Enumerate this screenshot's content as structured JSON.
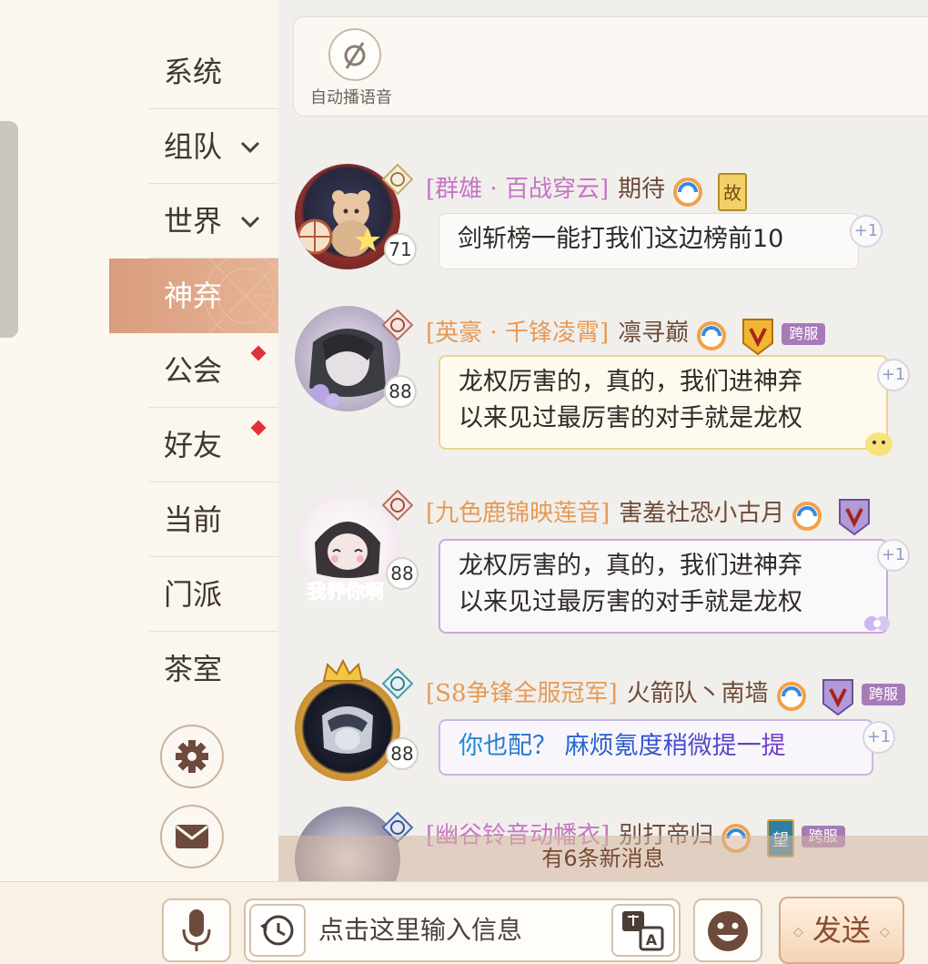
{
  "sidebar": {
    "items": [
      {
        "label": "系统",
        "active": false,
        "dropdown": false,
        "dot": false
      },
      {
        "label": "组队",
        "active": false,
        "dropdown": true,
        "dot": false
      },
      {
        "label": "世界",
        "active": false,
        "dropdown": true,
        "dot": false
      },
      {
        "label": "神弃",
        "active": true,
        "dropdown": false,
        "dot": false
      },
      {
        "label": "公会",
        "active": false,
        "dropdown": false,
        "dot": true
      },
      {
        "label": "好友",
        "active": false,
        "dropdown": false,
        "dot": true
      },
      {
        "label": "当前",
        "active": false,
        "dropdown": false,
        "dot": false
      },
      {
        "label": "门派",
        "active": false,
        "dropdown": false,
        "dot": false
      },
      {
        "label": "茶室",
        "active": false,
        "dropdown": false,
        "dot": false
      }
    ],
    "settings_icon": "gear-icon",
    "mail_icon": "mail-icon"
  },
  "auto_voice": {
    "label": "自动播语音",
    "icon": "mute-icon"
  },
  "messages": [
    {
      "guild": "[群雄 · 百战穿云]",
      "name": "期待",
      "level": "71",
      "badge": "故",
      "cross": "",
      "lines": [
        "剑斩榜一能打我们这边榜前10"
      ],
      "plus": "+1"
    },
    {
      "guild": "[英豪 · 千锋凌霄]",
      "name": "凛寻巅",
      "level": "88",
      "badge": "",
      "cross": "跨服",
      "lines": [
        "龙权厉害的，真的，我们进神弃",
        "以来见过最厉害的对手就是龙权"
      ],
      "plus": "+1"
    },
    {
      "guild": "[九色鹿锦映莲音]",
      "name": "害羞社恐小古月",
      "level": "88",
      "badge": "",
      "cross": "",
      "avatar_caption": "我养你啊",
      "lines": [
        "龙权厉害的，真的，我们进神弃",
        "以来见过最厉害的对手就是龙权"
      ],
      "plus": "+1"
    },
    {
      "guild": "[S8争锋全服冠军]",
      "name": "火箭队丶南墙",
      "level": "88",
      "badge": "",
      "cross": "跨服",
      "lines": [
        "你也配？ 麻烦氪度稍微提一提"
      ],
      "plus": "+1"
    },
    {
      "guild": "[幽谷铃音动幡衣]",
      "name": "别打帝归",
      "level": "",
      "badge": "望",
      "cross": "跨服",
      "lines": [],
      "plus": ""
    }
  ],
  "new_messages_banner": "有6条新消息",
  "bottom_bar": {
    "mic_icon": "microphone-icon",
    "history_icon": "history-icon",
    "input_placeholder": "点击这里输入信息",
    "translate_icon": "translate-icon",
    "emoji_icon": "smiley-icon",
    "send_label": "发送"
  },
  "colors": {
    "accent": "#d99d7d",
    "guild_text": "#e59a57",
    "name_text": "#6d4a36",
    "dot": "#e0313b"
  }
}
